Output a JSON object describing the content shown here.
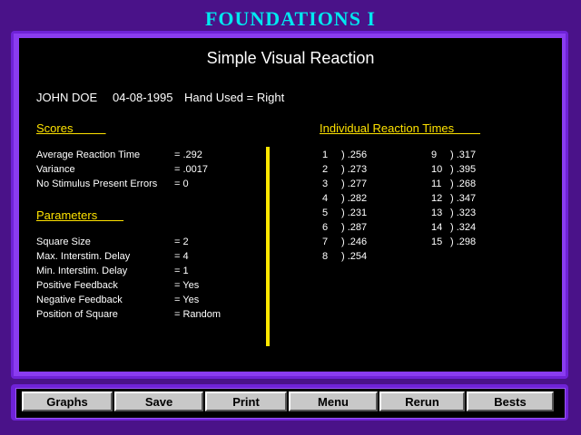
{
  "app": {
    "title": "FOUNDATIONS  I"
  },
  "report": {
    "heading": "Simple Visual Reaction",
    "subject": "JOHN DOE",
    "date": "04-08-1995",
    "hand": "Hand Used = Right"
  },
  "scores": {
    "title": "Scores          ",
    "rows": [
      {
        "label": "Average Reaction Time",
        "value": "=  .292"
      },
      {
        "label": "Variance",
        "value": "=  .0017"
      },
      {
        "label": "No Stimulus Present Errors",
        "value": "=  0"
      }
    ]
  },
  "parameters": {
    "title": "Parameters        ",
    "rows": [
      {
        "label": "Square Size",
        "value": "=  2"
      },
      {
        "label": "Max. Interstim. Delay",
        "value": "=  4"
      },
      {
        "label": "Min. Interstim. Delay",
        "value": "=  1"
      },
      {
        "label": "Positive Feedback",
        "value": "= Yes"
      },
      {
        "label": "Negative Feedback",
        "value": "= Yes"
      },
      {
        "label": "Position of Square",
        "value": "= Random"
      }
    ]
  },
  "reaction_times": {
    "title": "Individual Reaction Times        ",
    "left": [
      {
        "n": "1",
        "v": ")  .256"
      },
      {
        "n": "2",
        "v": ")  .273"
      },
      {
        "n": "3",
        "v": ")  .277"
      },
      {
        "n": "4",
        "v": ")  .282"
      },
      {
        "n": "5",
        "v": ")  .231"
      },
      {
        "n": "6",
        "v": ")  .287"
      },
      {
        "n": "7",
        "v": ")  .246"
      },
      {
        "n": "8",
        "v": ")  .254"
      }
    ],
    "right": [
      {
        "n": "9",
        "v": ")  .317"
      },
      {
        "n": "10",
        "v": ")  .395"
      },
      {
        "n": "11",
        "v": ")  .268"
      },
      {
        "n": "12",
        "v": ")  .347"
      },
      {
        "n": "13",
        "v": ")  .323"
      },
      {
        "n": "14",
        "v": ")  .324"
      },
      {
        "n": "15",
        "v": ")  .298"
      }
    ]
  },
  "buttons": {
    "graphs": "Graphs",
    "save": "Save",
    "print": "Print",
    "menu": "Menu",
    "rerun": "Rerun",
    "bests": "Bests"
  },
  "colors": {
    "accent": "#ffe300",
    "title": "#00e8f0",
    "frame": "#4a1289"
  }
}
